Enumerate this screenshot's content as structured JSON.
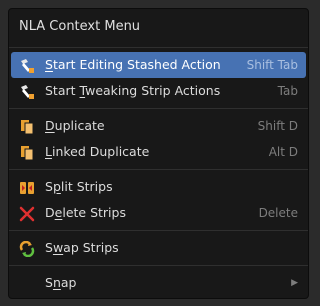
{
  "menu": {
    "title": "NLA Context Menu",
    "items": [
      {
        "label_pre": "",
        "label_u": "S",
        "label_post": "tart Editing Stashed Action",
        "shortcut": "Shift Tab",
        "icon": "tweak-icon"
      },
      {
        "label_pre": "Start ",
        "label_u": "T",
        "label_post": "weaking Strip Actions",
        "shortcut": "Tab",
        "icon": "tweak-icon"
      },
      {
        "label_pre": "",
        "label_u": "D",
        "label_post": "uplicate",
        "shortcut": "Shift D",
        "icon": "duplicate-icon"
      },
      {
        "label_pre": "",
        "label_u": "L",
        "label_post": "inked Duplicate",
        "shortcut": "Alt D",
        "icon": "duplicate-icon"
      },
      {
        "label_pre": "S",
        "label_u": "p",
        "label_post": "lit Strips",
        "shortcut": "",
        "icon": "split-icon"
      },
      {
        "label_pre": "D",
        "label_u": "e",
        "label_post": "lete Strips",
        "shortcut": "Delete",
        "icon": "delete-icon"
      },
      {
        "label_pre": "S",
        "label_u": "w",
        "label_post": "ap Strips",
        "shortcut": "",
        "icon": "swap-icon"
      },
      {
        "label_pre": "S",
        "label_u": "n",
        "label_post": "ap",
        "shortcut": "",
        "icon": ""
      }
    ]
  },
  "colors": {
    "menu_bg": "#181818",
    "highlight": "#4772b3",
    "text": "#dcdcdc",
    "shortcut": "#7d7d7d"
  }
}
